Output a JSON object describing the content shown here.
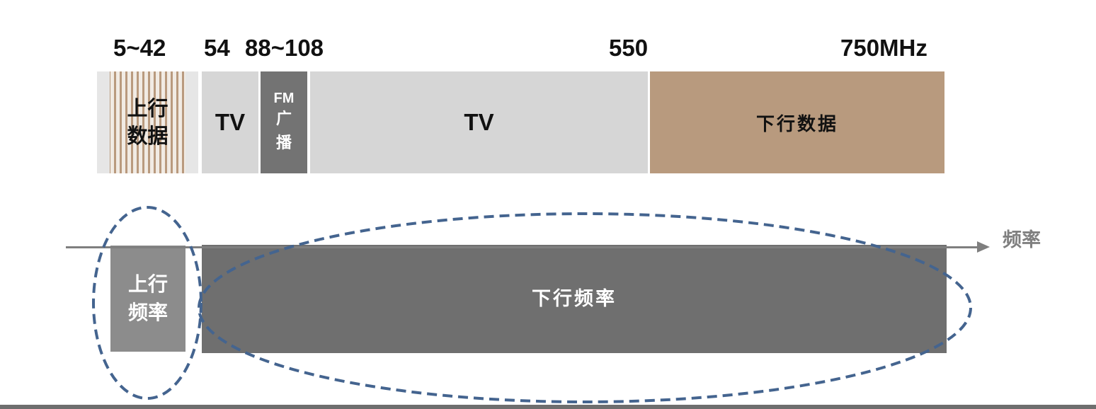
{
  "frequency_labels": {
    "f1": "5~42",
    "f2": "54",
    "f3": "88~108",
    "f4": "550",
    "f5": "750MHz"
  },
  "top_band": {
    "upstream_line1": "上行",
    "upstream_line2": "数据",
    "tv_low": "TV",
    "fm_title": "FM",
    "fm_sub": "广播",
    "tv_high": "TV",
    "downstream_data": "下行数据"
  },
  "bottom_band": {
    "upstream_line1": "上行",
    "upstream_line2": "频率",
    "downstream": "下行频率",
    "axis_label": "频率"
  },
  "colors": {
    "upstream_stripe": "#b99a7e",
    "tv_band": "#d6d6d6",
    "fm_band": "#737373",
    "downstream_data": "#b89a7e",
    "upstream_box": "#8c8c8c",
    "downstream_box": "#6f6f6f",
    "ellipse_dash": "#44648f",
    "axis": "#7f7f7f"
  }
}
